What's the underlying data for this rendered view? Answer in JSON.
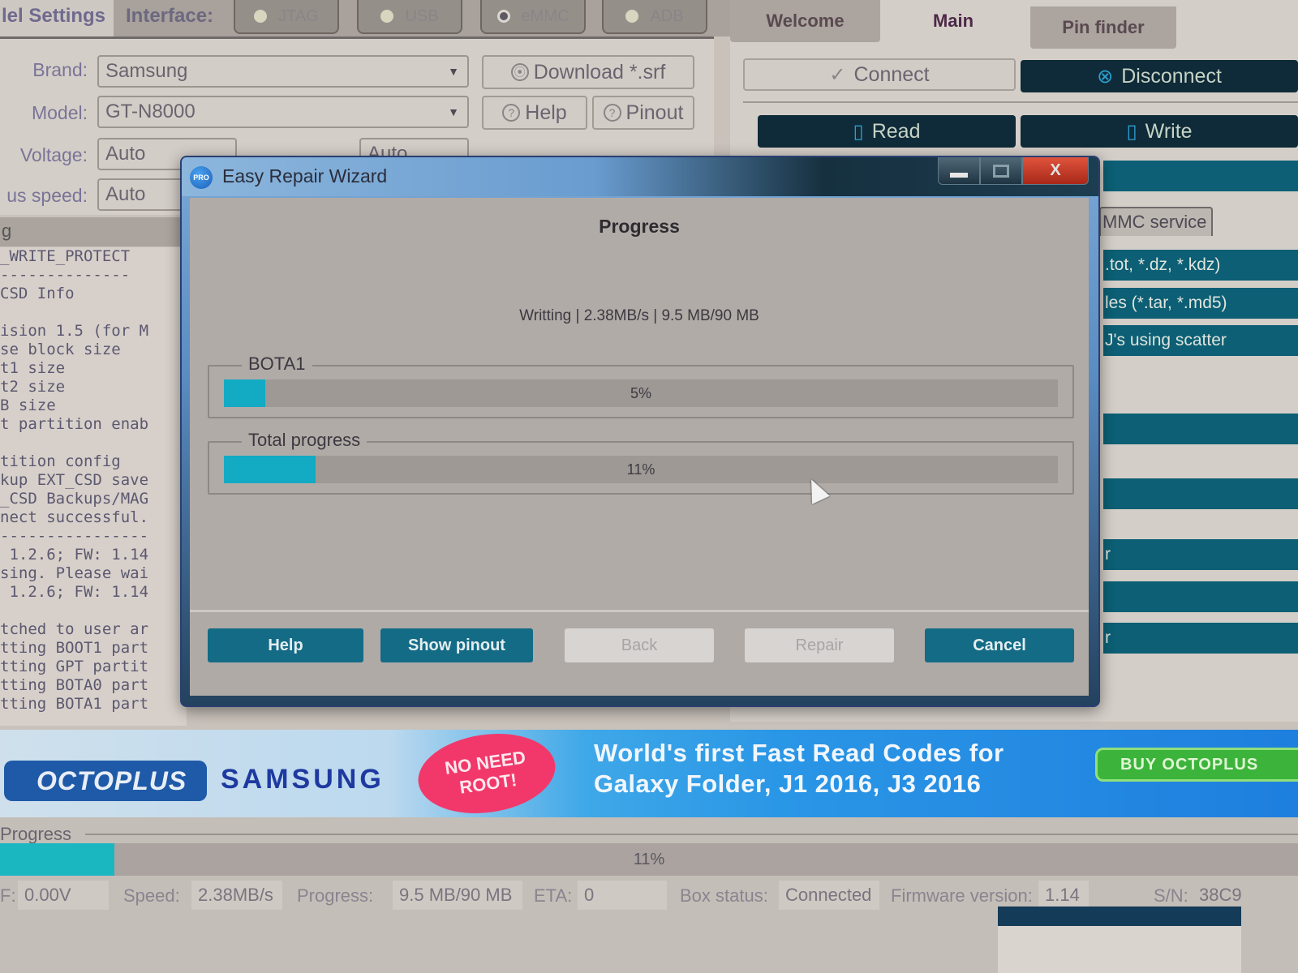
{
  "app": {
    "model_settings_title": "lel Settings",
    "interface_label": "Interface:",
    "interfaces": [
      {
        "label": "JTAG",
        "selected": false
      },
      {
        "label": "USB",
        "selected": false
      },
      {
        "label": "eMMC",
        "selected": true
      },
      {
        "label": "ADB",
        "selected": false
      }
    ],
    "fields": {
      "brand_label": "Brand:",
      "brand_value": "Samsung",
      "model_label": "Model:",
      "model_value": "GT-N8000",
      "voltage_label": "Voltage:",
      "voltage_value": "Auto",
      "bus_speed_label": "us speed:",
      "bus_speed_value": "Auto",
      "bus_mode_value": "Auto"
    },
    "buttons": {
      "download": "Download *.srf",
      "help": "Help",
      "pinout": "Pinout"
    },
    "icons": {
      "download": "⦿",
      "help": "?",
      "connect": "✓",
      "disconnect": "⊗",
      "read": "▯",
      "write": "▯",
      "caret": "▼"
    }
  },
  "log": {
    "header": "g",
    "lines": [
      "_WRITE_PROTECT",
      "--------------",
      "CSD Info",
      "",
      "ision 1.5 (for M",
      "se block size",
      "t1 size",
      "t2 size",
      "B size",
      "t partition enab",
      "",
      "tition config",
      "kup EXT_CSD save",
      "_CSD Backups/MAG",
      "nect successful.",
      "----------------",
      " 1.2.6; FW: 1.14",
      "sing. Please wai",
      " 1.2.6; FW: 1.14",
      "",
      "tched to user ar",
      "tting BOOT1 part",
      "tting GPT partit",
      "tting BOTA0 part",
      "tting BOTA1 part"
    ]
  },
  "right_panel": {
    "tabs": [
      {
        "label": "Welcome",
        "active": false
      },
      {
        "label": "Main",
        "active": true
      },
      {
        "label": "Pin finder",
        "active": false
      }
    ],
    "connect_label": "Connect",
    "disconnect_label": "Disconnect",
    "read_label": "Read",
    "write_label": "Write",
    "emmc_tab_label": "MMC service",
    "rows": [
      ".tot, *.dz, *.kdz)",
      "les (*.tar, *.md5)",
      "J's using scatter",
      "",
      "",
      "r",
      "",
      "r"
    ]
  },
  "dialog": {
    "title": "Easy Repair Wizard",
    "icon_text": "PRO",
    "heading": "Progress",
    "status_line": "Writting | 2.38MB/s  |  9.5 MB/90 MB",
    "partition_group": {
      "label": "BOTA1",
      "percent": 5,
      "percent_text": "5%"
    },
    "total_group": {
      "label": "Total progress",
      "percent": 11,
      "percent_text": "11%"
    },
    "buttons": {
      "help": "Help",
      "show_pinout": "Show pinout",
      "back": "Back",
      "repair": "Repair",
      "cancel": "Cancel"
    },
    "window_controls": {
      "minimize": "minimize",
      "maximize": "maximize",
      "close": "X"
    }
  },
  "ad": {
    "brand": "OCTOPLUS",
    "samsung": "SAMSUNG",
    "badge_line1": "NO NEED",
    "badge_line2": "ROOT!",
    "headline_line1": "World's first Fast Read Codes for",
    "headline_line2": "Galaxy Folder, J1 2016, J3 2016",
    "cta": "BUY OCTOPLUS"
  },
  "bottom": {
    "progress_label": "Progress",
    "progress_percent": 11,
    "progress_text": "11%",
    "status": {
      "vcc_label": "F:",
      "vcc_value": "0.00V",
      "speed_label": "Speed:",
      "speed_value": "2.38MB/s",
      "progress_label": "Progress:",
      "progress_value": "9.5 MB/90 MB",
      "eta_label": "ETA:",
      "eta_value": "0",
      "box_status_label": "Box status:",
      "box_status_value": "Connected",
      "firmware_label": "Firmware version:",
      "firmware_value": "1.14",
      "sn_label": "S/N:",
      "sn_value": "38C9"
    }
  },
  "colors": {
    "accent_teal": "#136b86",
    "progress_fill": "#13aac4",
    "dark_button": "#0f2a38",
    "close_red": "#c83a24",
    "ad_badge": "#f2386a",
    "ad_cta": "#3cb43c"
  }
}
